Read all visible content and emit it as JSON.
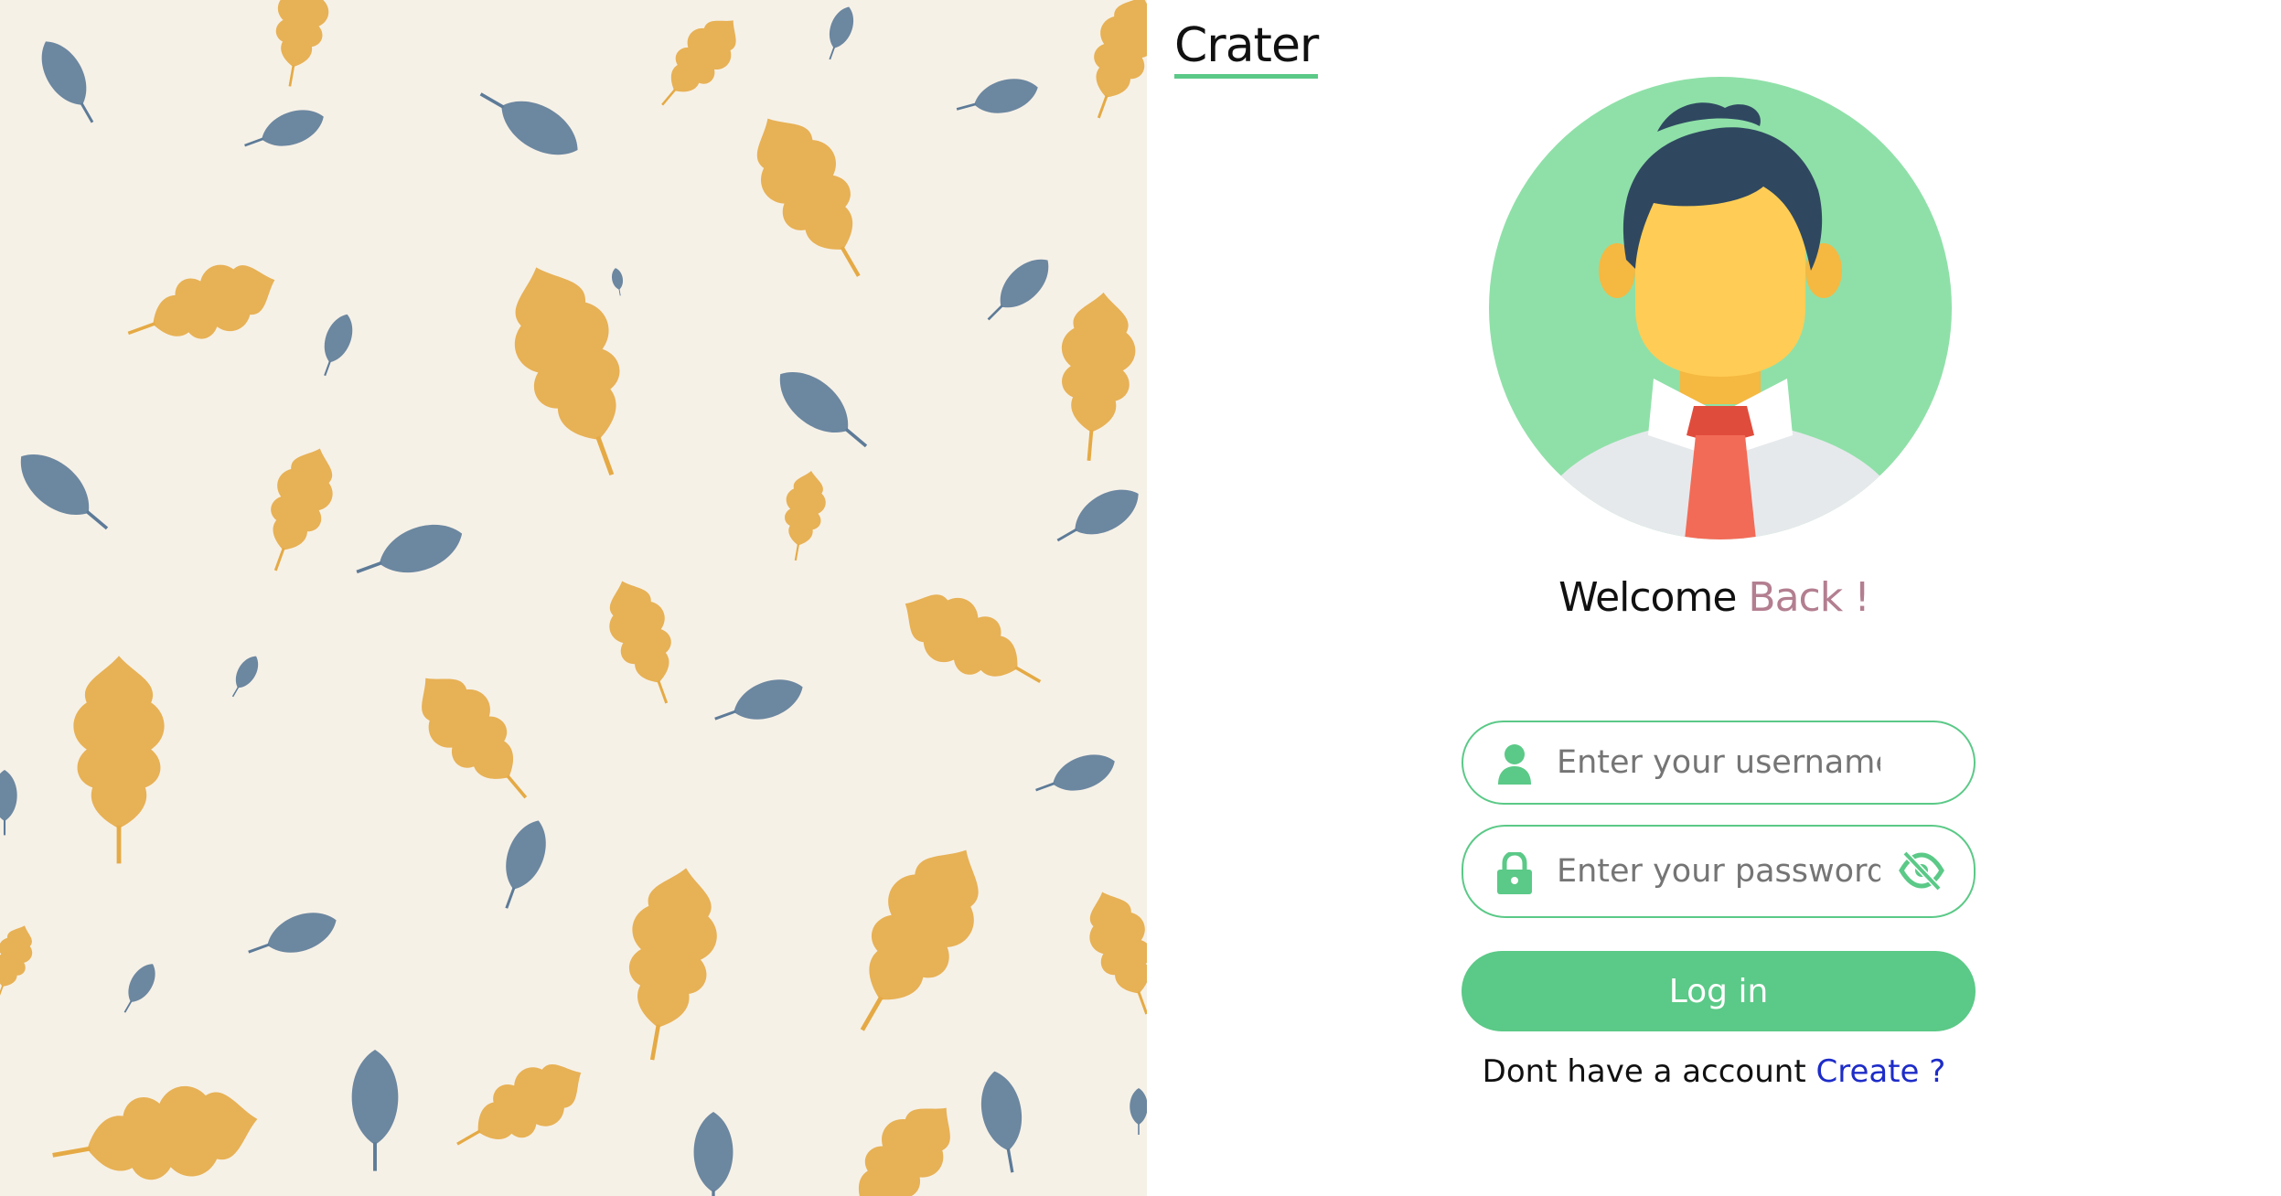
{
  "brand": {
    "name": "Crater"
  },
  "welcome": {
    "text": "Welcome",
    "accent": "Back !"
  },
  "form": {
    "username_placeholder": "Enter your username",
    "username_value": "",
    "password_placeholder": "Enter your password",
    "password_value": "",
    "login_label": "Log in"
  },
  "signup": {
    "prompt": "Dont have a account",
    "link": "Create ?"
  },
  "icons": {
    "username": "user-icon",
    "password": "lock-icon",
    "visibility": "eye-slash-icon"
  },
  "colors": {
    "accent_green": "#5bc987",
    "welcome_accent": "#b37f90",
    "link": "#1d2cc8",
    "background_left": "#f6f1e7",
    "leaf_gold": "#e5aa45",
    "leaf_blue": "#5d7b98"
  }
}
